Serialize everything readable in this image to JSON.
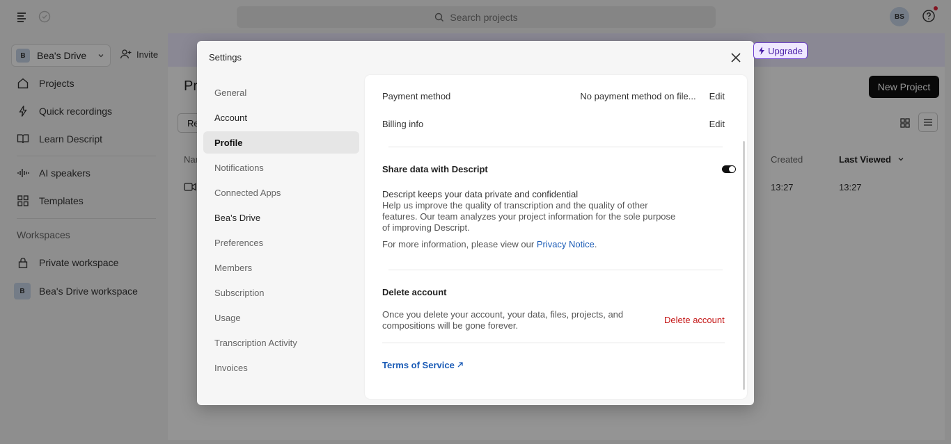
{
  "topbar": {
    "search_placeholder": "Search projects",
    "avatar_initials": "BS"
  },
  "sidebar": {
    "drive_name": "Bea's Drive",
    "drive_badge": "B",
    "invite_label": "Invite",
    "items": [
      {
        "label": "Projects",
        "icon": "home-icon"
      },
      {
        "label": "Quick recordings",
        "icon": "bolt-icon"
      },
      {
        "label": "Learn Descript",
        "icon": "book-icon"
      },
      {
        "label": "AI speakers",
        "icon": "waveform-icon"
      },
      {
        "label": "Templates",
        "icon": "grid-icon"
      }
    ],
    "workspaces_title": "Workspaces",
    "workspaces": [
      {
        "label": "Private workspace",
        "icon": "lock-icon"
      },
      {
        "label": "Bea's Drive workspace",
        "badge": "B"
      }
    ]
  },
  "main": {
    "page_title": "Pr",
    "upgrade_label": "Upgrade",
    "new_project_label": "New Project",
    "recent_tab": "Re",
    "columns": {
      "name": "Nar",
      "created": "Created",
      "last_viewed": "Last Viewed"
    },
    "row": {
      "created": "13:27",
      "last_viewed": "13:27"
    }
  },
  "modal": {
    "title": "Settings",
    "nav": [
      {
        "label": "General",
        "type": "item"
      },
      {
        "label": "Account",
        "type": "section"
      },
      {
        "label": "Profile",
        "type": "active"
      },
      {
        "label": "Notifications",
        "type": "item"
      },
      {
        "label": "Connected Apps",
        "type": "item"
      },
      {
        "label": "Bea's Drive",
        "type": "section"
      },
      {
        "label": "Preferences",
        "type": "item"
      },
      {
        "label": "Members",
        "type": "item"
      },
      {
        "label": "Subscription",
        "type": "item"
      },
      {
        "label": "Usage",
        "type": "item"
      },
      {
        "label": "Transcription Activity",
        "type": "item"
      },
      {
        "label": "Invoices",
        "type": "item"
      }
    ],
    "payment": {
      "label": "Payment method",
      "value": "No payment method on file...",
      "edit": "Edit"
    },
    "billing": {
      "label": "Billing info",
      "edit": "Edit"
    },
    "share": {
      "label": "Share data with Descript",
      "toggle_on": true,
      "line1": "Descript keeps your data private and confidential",
      "line2": "Help us improve the quality of transcription and the quality of other",
      "line3": "features. Our team analyzes your project information for the sole purpose",
      "line4": "of improving Descript.",
      "more_prefix": "For more information, please view our ",
      "privacy_link": "Privacy Notice",
      "more_suffix": "."
    },
    "delete": {
      "title": "Delete account",
      "line1": "Once you delete your account, your data, files, projects, and",
      "line2": "compositions will be gone forever.",
      "button": "Delete account"
    },
    "tos": "Terms of Service"
  },
  "colors": {
    "accent_link": "#1a5bb6",
    "danger": "#c41616",
    "upgrade": "#6d3fd1"
  }
}
